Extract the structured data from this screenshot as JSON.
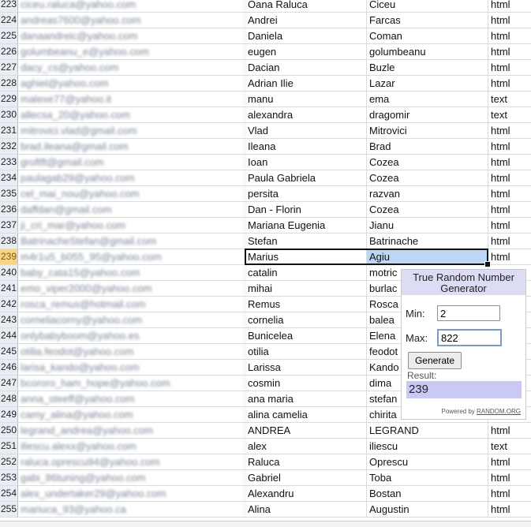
{
  "spreadsheet": {
    "active_row": 239,
    "rows": [
      {
        "num": "223",
        "email": "ciceu.raluca@yahoo.com",
        "first": "Oana Raluca",
        "last": "Ciceu",
        "format": "html"
      },
      {
        "num": "224",
        "email": "andreas7600@yahoo.com",
        "first": "Andrei",
        "last": "Farcas",
        "format": "html"
      },
      {
        "num": "225",
        "email": "danaandreic@yahoo.com",
        "first": "Daniela",
        "last": "Coman",
        "format": "html"
      },
      {
        "num": "226",
        "email": "golumbeanu_e@yahoo.com",
        "first": "eugen",
        "last": "golumbeanu",
        "format": "html"
      },
      {
        "num": "227",
        "email": "dacy_cs@yahoo.com",
        "first": "Dacian",
        "last": "Buzle",
        "format": "html"
      },
      {
        "num": "228",
        "email": "aghiel@yahoo.com",
        "first": "Adrian Ilie",
        "last": "Lazar",
        "format": "html"
      },
      {
        "num": "229",
        "email": "malexe77@yahoo.it",
        "first": "manu",
        "last": "ema",
        "format": "text"
      },
      {
        "num": "230",
        "email": "allecsa_20@yahoo.com",
        "first": "alexandra",
        "last": "dragomir",
        "format": "text"
      },
      {
        "num": "231",
        "email": "mitrovici.vlad@gmail.com",
        "first": "Vlad",
        "last": "Mitrovici",
        "format": "html"
      },
      {
        "num": "232",
        "email": "brad.ileana@gmail.com",
        "first": "Ileana",
        "last": "Brad",
        "format": "html"
      },
      {
        "num": "233",
        "email": "groftft@gmail.com",
        "first": "Ioan",
        "last": "Cozea",
        "format": "html"
      },
      {
        "num": "234",
        "email": "paulagab29@yahoo.com",
        "first": "Paula Gabriela",
        "last": "Cozea",
        "format": "html"
      },
      {
        "num": "235",
        "email": "cel_mai_nou@yahoo.com",
        "first": "persita",
        "last": "razvan",
        "format": "html"
      },
      {
        "num": "236",
        "email": "daffdan@gmail.com",
        "first": "Dan - Florin",
        "last": "Cozea",
        "format": "html"
      },
      {
        "num": "237",
        "email": "ji_cri_mar@yahoo.com",
        "first": "Mariana Eugenia",
        "last": "Jianu",
        "format": "html"
      },
      {
        "num": "238",
        "email": "BatrinacheStefan@gmail.com",
        "first": "Stefan",
        "last": "Batrinache",
        "format": "html"
      },
      {
        "num": "239",
        "email": "m4r1u5_b055_95@yahoo.com",
        "first": "Marius",
        "last": "Agiu",
        "format": "html"
      },
      {
        "num": "240",
        "email": "baby_cata15@yahoo.com",
        "first": "catalin",
        "last": "motric",
        "format": ""
      },
      {
        "num": "241",
        "email": "emo_viper2000@yahoo.com",
        "first": "mihai",
        "last": "burlac",
        "format": ""
      },
      {
        "num": "242",
        "email": "rosca_remus@hotmail.com",
        "first": "Remus",
        "last": "Rosca",
        "format": ""
      },
      {
        "num": "243",
        "email": "corneliacorny@yahoo.com",
        "first": "cornelia",
        "last": "balea",
        "format": ""
      },
      {
        "num": "244",
        "email": "onlybabyboom@yahoo.es",
        "first": "Bunicelea",
        "last": "Elena",
        "format": ""
      },
      {
        "num": "245",
        "email": "otilia.feodot@yahoo.com",
        "first": "otilia",
        "last": "feodot",
        "format": ""
      },
      {
        "num": "246",
        "email": "larisa_kando@yahoo.com",
        "first": "Larissa",
        "last": "Kando",
        "format": ""
      },
      {
        "num": "247",
        "email": "bcororo_ham_hope@yahoo.com",
        "first": "cosmin",
        "last": "dima",
        "format": ""
      },
      {
        "num": "248",
        "email": "anna_steeff@yahoo.com",
        "first": "ana maria",
        "last": "stefan",
        "format": ""
      },
      {
        "num": "249",
        "email": "camy_alina@yahoo.com",
        "first": "alina camelia",
        "last": "chirita",
        "format": ""
      },
      {
        "num": "250",
        "email": "legrand_andrea@yahoo.com",
        "first": "ANDREA",
        "last": "LEGRAND",
        "format": "html"
      },
      {
        "num": "251",
        "email": "iliescu.alexx@yahoo.com",
        "first": "alex",
        "last": "iliescu",
        "format": "text"
      },
      {
        "num": "252",
        "email": "raluca.oprescu94@yahoo.com",
        "first": "Raluca",
        "last": "Oprescu",
        "format": "html"
      },
      {
        "num": "253",
        "email": "gabi_86tuning@yahoo.com",
        "first": "Gabriel",
        "last": "Toba",
        "format": "html"
      },
      {
        "num": "254",
        "email": "alex_undertaker29@yahoo.com",
        "first": "Alexandru",
        "last": "Bostan",
        "format": "html"
      },
      {
        "num": "255",
        "email": "mariuca_93@yahoo.ca",
        "first": "Alina",
        "last": "Augustin",
        "format": "html"
      }
    ]
  },
  "rng_widget": {
    "title": "True Random Number Generator",
    "min_label": "Min:",
    "min_value": "2",
    "max_label": "Max:",
    "max_value": "822",
    "generate_label": "Generate",
    "result_label": "Result:",
    "result_value": "239",
    "powered_by": "Powered by",
    "powered_link": "RANDOM.ORG"
  }
}
